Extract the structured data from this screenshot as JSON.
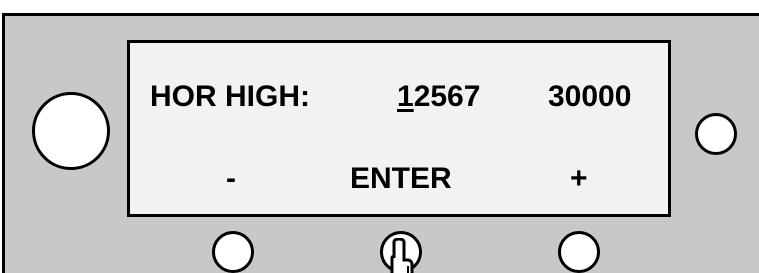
{
  "display": {
    "parameter_label": "HOR HIGH:",
    "current_value_first_digit": "1",
    "current_value_rest": "2567",
    "max_value": "30000",
    "soft_key_left": "-",
    "soft_key_center": "ENTER",
    "soft_key_right": "+"
  },
  "icons": {
    "pointer": "hand-pointer-icon"
  },
  "colors": {
    "panel": "#c8c8c8",
    "screen": "#f2f2f2",
    "outline": "#000000"
  }
}
